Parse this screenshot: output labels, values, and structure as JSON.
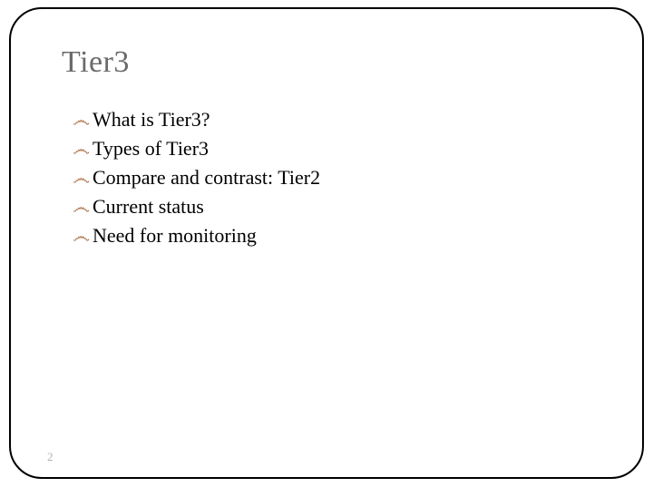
{
  "slide": {
    "title": "Tier3",
    "bullets": [
      "What is Tier3?",
      "Types of Tier3",
      "Compare and contrast: Tier2",
      "Current status",
      "Need for monitoring"
    ],
    "bullet_glyph": "෴",
    "page_number": "2"
  }
}
